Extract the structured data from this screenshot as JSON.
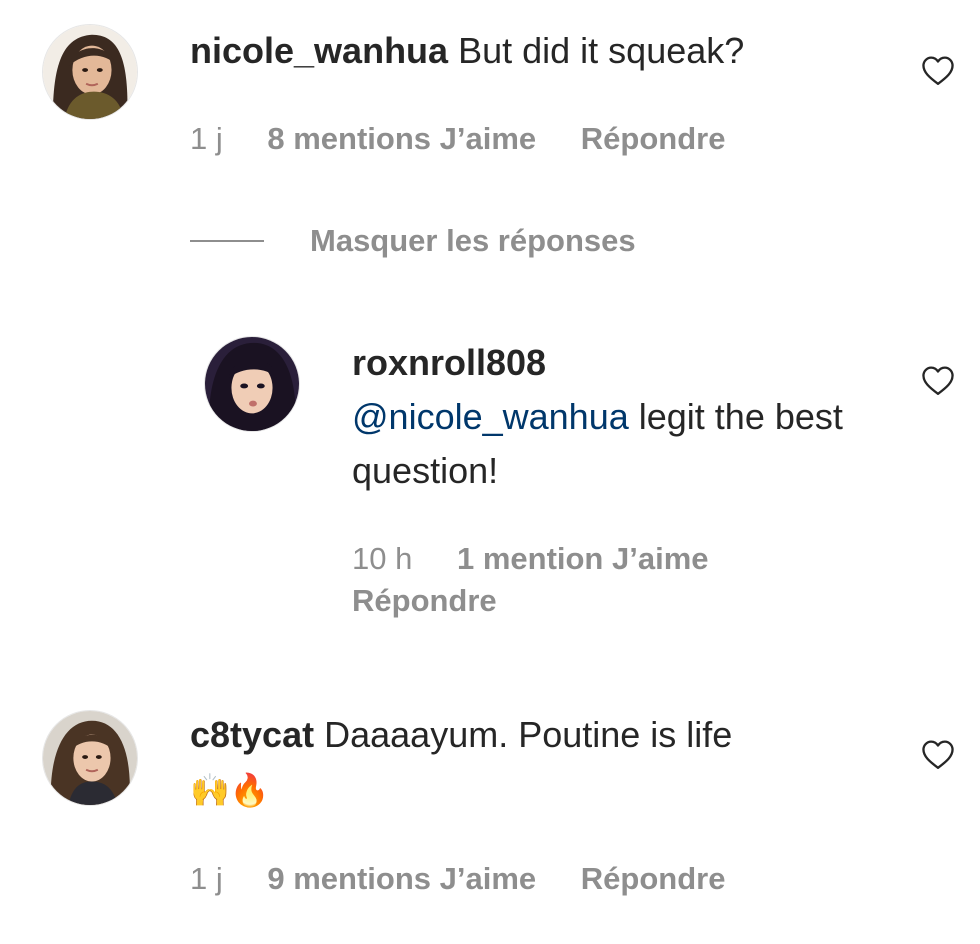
{
  "comments": [
    {
      "username": "nicole_wanhua",
      "text": "But did it squeak?",
      "time": "1 j",
      "likes": "8 mentions J’aime",
      "reply": "Répondre"
    },
    {
      "username": "roxnroll808",
      "mention": "@nicole_wanhua",
      "text": "legit the best question!",
      "time": "10 h",
      "likes": "1 mention J’aime",
      "reply": "Répondre"
    },
    {
      "username": "c8tycat",
      "text": "Daaaayum. Poutine is life",
      "emoji": "🙌🔥",
      "time": "1 j",
      "likes": "9 mentions J’aime",
      "reply": "Répondre"
    }
  ],
  "hide_replies_label": "Masquer les réponses",
  "icons": {
    "like": "heart-outline-icon"
  },
  "colors": {
    "text": "#262626",
    "secondary": "#8e8e8e",
    "mention": "#00376b",
    "background": "#ffffff"
  }
}
